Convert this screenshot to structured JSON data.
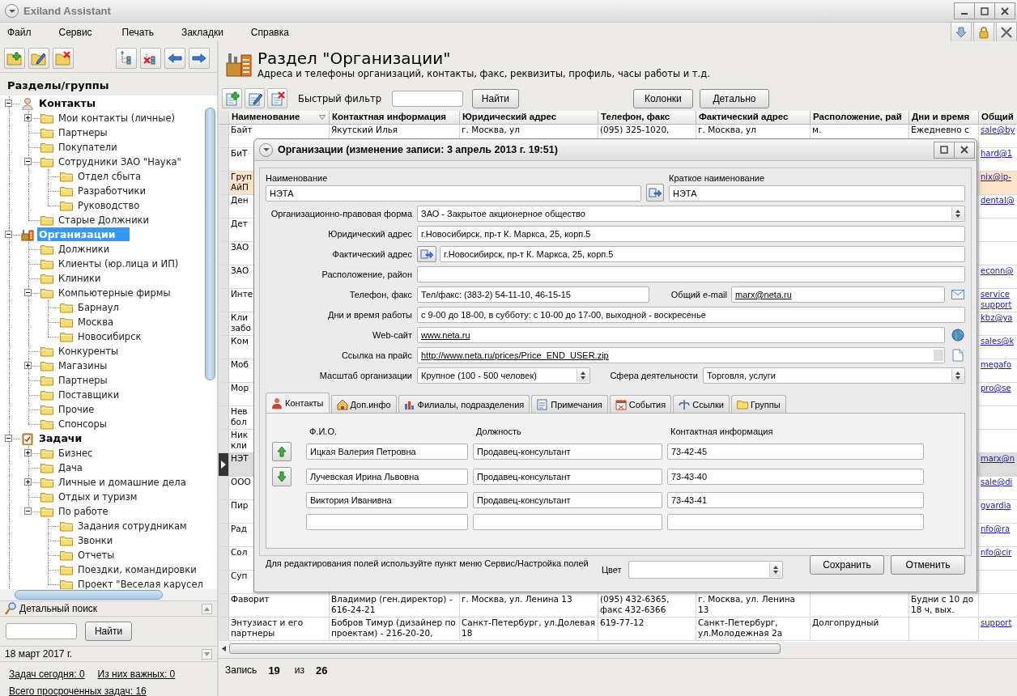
{
  "window": {
    "title": "Exiland Assistant"
  },
  "menu": [
    "Файл",
    "Сервис",
    "Печать",
    "Закладки",
    "Справка"
  ],
  "sidebar": {
    "title": "Разделы/группы",
    "tree": [
      {
        "label": "Контакты",
        "kind": "person",
        "expanded": true,
        "selected": false,
        "children": [
          {
            "label": "Мои контакты (личные)",
            "expanded": false,
            "selected": false
          },
          {
            "label": "Партнеры",
            "selected": false
          },
          {
            "label": "Покупатели",
            "selected": false
          },
          {
            "label": "Сотрудники ЗАО \"Наука\"",
            "expanded": true,
            "selected": false,
            "children": [
              {
                "label": "Отдел сбыта",
                "selected": false
              },
              {
                "label": "Разработчики",
                "selected": false
              },
              {
                "label": "Руководство",
                "selected": false
              }
            ]
          },
          {
            "label": "Старые Должники",
            "selected": false
          }
        ]
      },
      {
        "label": "Организации",
        "kind": "factory",
        "expanded": true,
        "selected": true,
        "children": [
          {
            "label": "Должники",
            "selected": false
          },
          {
            "label": "Клиенты (юр.лица и ИП)",
            "selected": false
          },
          {
            "label": "Клиники",
            "selected": false
          },
          {
            "label": "Компьютерные фирмы",
            "expanded": true,
            "selected": false,
            "children": [
              {
                "label": "Барнаул",
                "selected": false
              },
              {
                "label": "Москва",
                "selected": false
              },
              {
                "label": "Новосибирск",
                "selected": false
              }
            ]
          },
          {
            "label": "Конкуренты",
            "selected": false
          },
          {
            "label": "Магазины",
            "expanded": false,
            "selected": false
          },
          {
            "label": "Партнеры",
            "selected": false
          },
          {
            "label": "Поставщики",
            "selected": false
          },
          {
            "label": "Прочие",
            "selected": false
          },
          {
            "label": "Спонсоры",
            "selected": false
          }
        ]
      },
      {
        "label": "Задачи",
        "kind": "clipboard",
        "expanded": true,
        "selected": false,
        "children": [
          {
            "label": "Бизнес",
            "expanded": false,
            "selected": false
          },
          {
            "label": "Дача",
            "selected": false
          },
          {
            "label": "Личные и домашние дела",
            "expanded": false,
            "selected": false
          },
          {
            "label": "Отдых и туризм",
            "selected": false
          },
          {
            "label": "По работе",
            "expanded": true,
            "selected": false,
            "children": [
              {
                "label": "Задания сотрудникам",
                "selected": false
              },
              {
                "label": "Звонки",
                "selected": false
              },
              {
                "label": "Отчеты",
                "selected": false
              },
              {
                "label": "Поездки, командировки",
                "selected": false
              },
              {
                "label": "Проект \"Веселая карусел",
                "selected": false
              }
            ]
          }
        ]
      }
    ],
    "search": {
      "title": "Детальный поиск",
      "button": "Найти"
    },
    "date": "18 март 2017 г.",
    "links": [
      "Задач сегодня: 0",
      "Из них важных: 0",
      "Всего просроченных задач: 16"
    ]
  },
  "section": {
    "title": "Раздел \"Организации\"",
    "subtitle": "Адреса и телефоны организаций, контакты, факс, реквизиты, профиль, часы работы и т.д."
  },
  "toolbar": {
    "filter_label": "Быстрый фильтр",
    "find_button": "Найти",
    "buttons": [
      "Колонки",
      "Детально"
    ]
  },
  "table": {
    "columns": [
      "Наименование",
      "Контактная информация",
      "Юридический адрес",
      "Телефон, факс",
      "Фактический адрес",
      "Расположение, рай",
      "Дни и время",
      "Общий"
    ],
    "rows": [
      {
        "name": "Байт",
        "contact": "Якутский Илья",
        "legal_address": "г. Москва, ул",
        "phone": "(095) 325-1020,",
        "actual_address": "г. Москва, ул",
        "location": "м.",
        "hours": "Ежедневно с",
        "email": "sale@by",
        "selected": false,
        "highlighted": false
      },
      {
        "name": "БиТ",
        "email": "hard@1",
        "selected": false,
        "highlighted": false
      },
      {
        "name": "Груп\nАйП",
        "email": "nix@ip-",
        "selected": false,
        "highlighted": true
      },
      {
        "name": "Ден",
        "email": "dental@",
        "selected": false,
        "highlighted": false
      },
      {
        "name": "Дет",
        "selected": false,
        "highlighted": false
      },
      {
        "name": "ЗАО",
        "selected": false,
        "highlighted": false
      },
      {
        "name": "ЗАО",
        "email": "econn@",
        "selected": false,
        "highlighted": false
      },
      {
        "name": "Инте",
        "email": "service\nsupport",
        "selected": false,
        "highlighted": false
      },
      {
        "name": "Кли\nзабо",
        "email": "kbz@ya",
        "selected": false,
        "highlighted": false
      },
      {
        "name": "Ком",
        "email": "sales@k",
        "selected": false,
        "highlighted": false
      },
      {
        "name": "Моб",
        "email": "megafo",
        "selected": false,
        "highlighted": false
      },
      {
        "name": "Мор",
        "email": "pro@se",
        "selected": false,
        "highlighted": false
      },
      {
        "name": "Нев\nбол",
        "selected": false,
        "highlighted": false
      },
      {
        "name": "Ник\nкли",
        "selected": false,
        "highlighted": false
      },
      {
        "name": "НЭТ",
        "email": "marx@n",
        "selected": true,
        "highlighted": false
      },
      {
        "name": "ООО",
        "email": "sale@di",
        "selected": false,
        "highlighted": false
      },
      {
        "name": "Пир",
        "email": "gvardia",
        "selected": false,
        "highlighted": false
      },
      {
        "name": "Рад",
        "email": "nfo@ra",
        "selected": false,
        "highlighted": false
      },
      {
        "name": "Сол",
        "email": "nfo@cir",
        "selected": false,
        "highlighted": false
      },
      {
        "name": "Суп",
        "selected": false,
        "highlighted": false
      },
      {
        "name": "Фаворит",
        "contact": "Владимир (ген.директор) - 616-24-21",
        "legal_address": "г. Москва, ул. Ленина 13",
        "phone": "(095) 432-6365, факс 432-6366",
        "actual_address": "г. Москва, ул. Ленина 13",
        "hours": "Будни с 10 до 18 ч, вых.",
        "selected": false,
        "highlighted": false
      },
      {
        "name": "Энтузиаст и его партнеры",
        "contact": "Бобров Тимур (дизайнер по проектам) - 216-20-20,",
        "legal_address": "Санкт-Петербург, ул.Долевая 18",
        "phone": "619-77-12",
        "actual_address": "Санкт-Петербург, ул.Молодежная 2а",
        "location": "Долгопрудный",
        "email": "support",
        "selected": false,
        "highlighted": false
      }
    ]
  },
  "status_bar": {
    "record_label": "Запись",
    "current": "19",
    "of_label": "из",
    "total": "26"
  },
  "dialog": {
    "title": "Организации  (изменение записи: 3 апрель 2013 г. 19:51)",
    "name": {
      "label": "Наименование",
      "value": "НЭТА"
    },
    "short_name": {
      "label": "Краткое наименование",
      "value": "НЭТА"
    },
    "legal_form": {
      "label": "Организационно-правовая форма",
      "value": "ЗАО - Закрытое акционерное общество"
    },
    "legal_address": {
      "label": "Юридический адрес",
      "value": "г.Новосибирск, пр-т К. Маркса, 25, корп.5"
    },
    "actual_address": {
      "label": "Фактический адрес",
      "value": "г.Новосибирск, пр-т К. Маркса, 25, корп.5"
    },
    "location": {
      "label": "Расположение, район"
    },
    "phone": {
      "label": "Телефон, факс",
      "value": "Тел/факс: (383-2) 54-11-10, 46-15-15"
    },
    "email": {
      "label": "Общий e-mail",
      "value": "marx@neta.ru"
    },
    "hours": {
      "label": "Дни и время работы",
      "value": "с 9-00 до 18-00, в субботу: с 10-00 до 17-00, выходной - воскресенье"
    },
    "website": {
      "label": "Web-сайт",
      "value": "www.neta.ru"
    },
    "price_link": {
      "label": "Ссылка на прайс",
      "value": "http://www.neta.ru/prices/Price_END_USER.zip"
    },
    "scale": {
      "label": "Масштаб организации",
      "value": "Крупное (100 - 500 человек)"
    },
    "sphere": {
      "label": "Сфера деятельности",
      "value": "Торговля, услуги"
    },
    "tabs": [
      {
        "label": "Контакты",
        "selected": true
      },
      {
        "label": "Доп.инфо",
        "selected": false
      },
      {
        "label": "Филиалы, подразделения",
        "selected": false
      },
      {
        "label": "Примечания",
        "selected": false
      },
      {
        "label": "События",
        "selected": false
      },
      {
        "label": "Ссылки",
        "selected": false
      },
      {
        "label": "Группы",
        "selected": false
      }
    ],
    "contacts": {
      "columns": [
        "Ф.И.О.",
        "Должность",
        "Контактная информация"
      ],
      "rows": [
        {
          "fio": "Ицкая Валерия Петровна",
          "position": "Продавец-консультант",
          "contact": "73-42-45"
        },
        {
          "fio": "Лучевская Ирина Львовна",
          "position": "Продавец-консультант",
          "contact": "73-43-40"
        },
        {
          "fio": "Виктория Иванивна",
          "position": "Продавец-консультант",
          "contact": "73-43-41"
        }
      ]
    },
    "hint": "Для редактирования полей используйте пункт меню Сервис/Настройка полей",
    "color_label": "Цвет",
    "buttons": [
      "Сохранить",
      "Отменить"
    ]
  }
}
